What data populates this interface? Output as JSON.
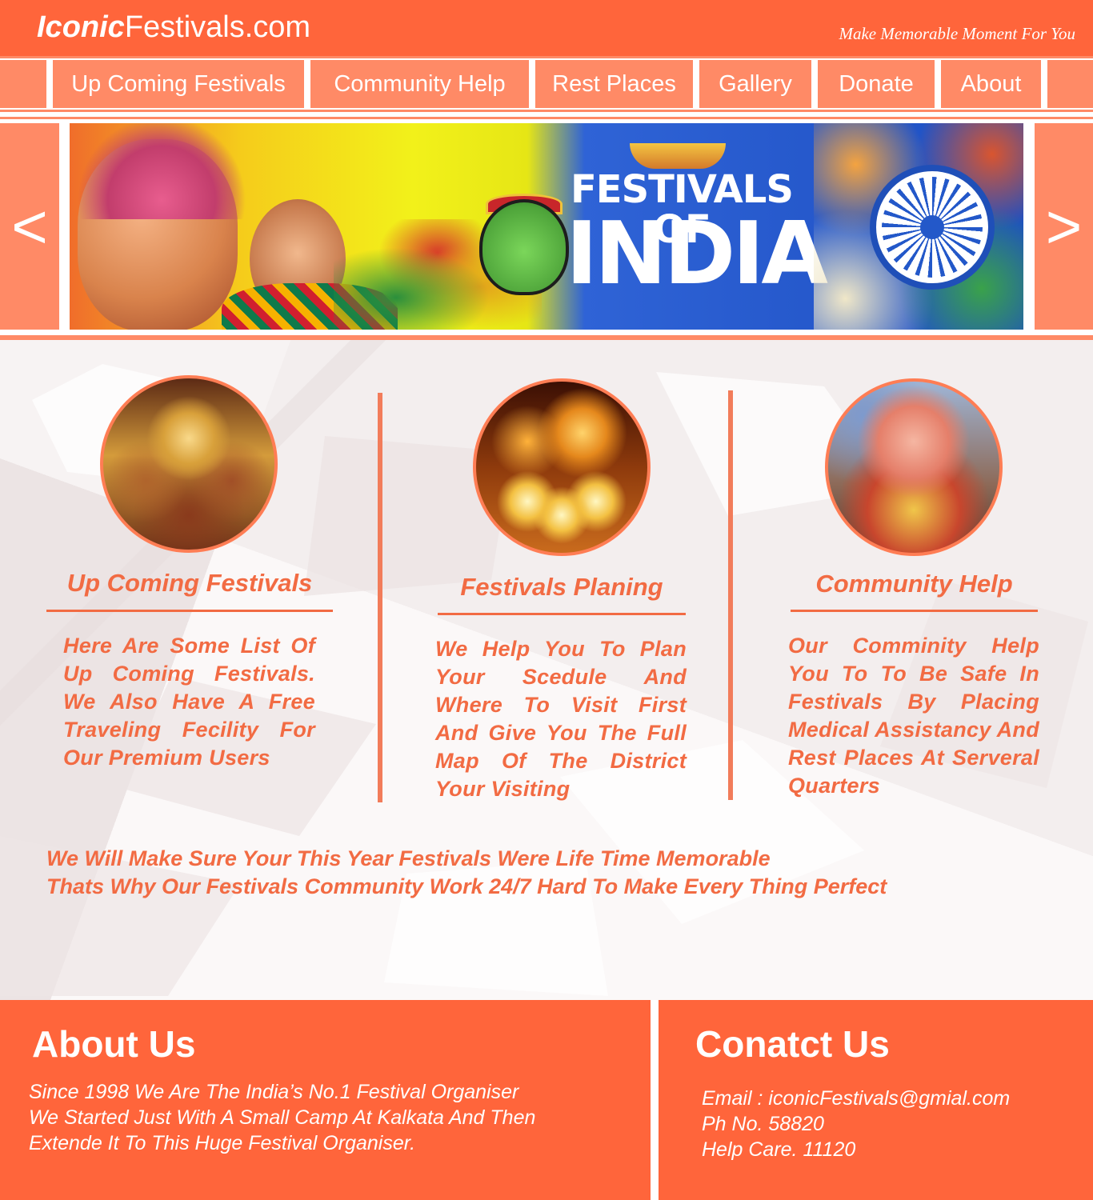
{
  "header": {
    "logo_bold": "Iconic",
    "logo_rest": "Festivals.com",
    "tagline": "Make Memorable Moment For You",
    "brand_color": "#ff653b"
  },
  "nav": {
    "items": [
      {
        "label": "Up Coming Festivals"
      },
      {
        "label": "Community Help"
      },
      {
        "label": "Rest Places"
      },
      {
        "label": "Gallery"
      },
      {
        "label": "Donate"
      },
      {
        "label": "About"
      }
    ],
    "tile_color": "#ff8a66"
  },
  "slider": {
    "prev_label": "<",
    "next_label": ">",
    "banner_title_small": "FESTIVALS OF",
    "banner_title_big": "INDIA"
  },
  "features": [
    {
      "title": "Up Coming Festivals",
      "text": "Here Are Some List Of Up Coming Festivals. We Also Have A Free Traveling Fecility For Our Premium Users",
      "image": "durga-idol-photo"
    },
    {
      "title": "Festivals Planing",
      "text": "We Help You To Plan Your Scedule And Where To Visit First And Give You The Full Map Of The District Your Visiting",
      "image": "candles-diya-photo"
    },
    {
      "title": "Community Help",
      "text": "Our Comminity Help You To To Be Safe In Festivals By Placing Medical Assistancy And Rest Places At Serveral Quarters",
      "image": "ganesh-idol-photo"
    }
  ],
  "closing": {
    "line1": "We Will Make Sure Your This Year Festivals Were Life Time Memorable",
    "line2": "Thats Why Our Festivals Community Work 24/7 Hard To Make Every Thing Perfect"
  },
  "footer": {
    "about": {
      "title": "About Us",
      "lines": [
        "Since 1998 We Are The India’s No.1 Festival Organiser",
        "We Started Just With A Small Camp At Kalkata And Then",
        "Extende It To This Huge Festival Organiser."
      ]
    },
    "contact": {
      "title": "Conatct Us",
      "email": "Email : iconicFestivals@gmial.com",
      "phone": "Ph No. 58820",
      "helpcare": "Help Care. 11120"
    }
  }
}
